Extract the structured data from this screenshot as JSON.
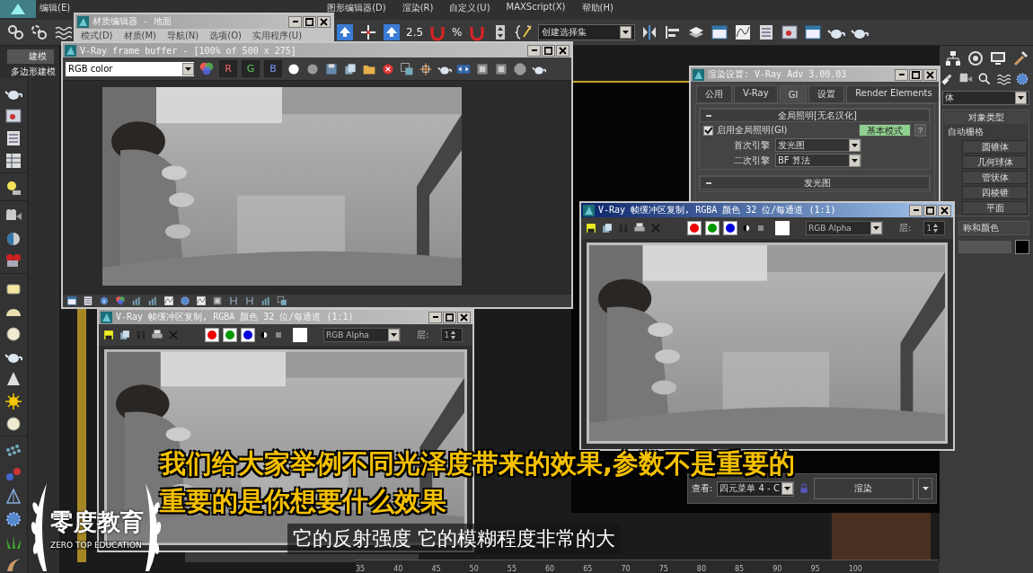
{
  "menu_bar": {
    "items": [
      "编辑(E)",
      "图形编辑器(D)",
      "渲染(R)",
      "自定义(U)",
      "MAXScript(X)",
      "帮助(H)"
    ]
  },
  "main_toolbar": {
    "snap_value": "2.5",
    "percent_label": "%",
    "selection_set": "创建选择集"
  },
  "ribbon": {
    "tab": "建模",
    "panel": "多边形建模"
  },
  "command_panel": {
    "category": "体",
    "section": "对象类型",
    "autogrid": "自动栅格",
    "buttons": [
      {
        "right": "圆锥体"
      },
      {
        "right": "几何球体"
      },
      {
        "right": "管状体"
      },
      {
        "right": "四棱锥"
      },
      {
        "right": "平面"
      }
    ],
    "name_section": "称和颜色"
  },
  "material_editor": {
    "title": "材质编辑器 - 地面",
    "active": false,
    "menu": [
      "模式(D)",
      "材质(M)",
      "导航(N)",
      "选项(O)",
      "实用程序(U)"
    ]
  },
  "frame_buffer": {
    "title": "V-Ray frame buffer - [100% of 500 x 275]",
    "active": false,
    "channel": "RGB color",
    "channel_buttons": [
      {
        "label": "R",
        "on": true
      },
      {
        "label": "G",
        "on": true
      },
      {
        "label": "B",
        "on": true
      }
    ]
  },
  "render_setup": {
    "title": "渲染设置: V-Ray Adv 3.00.03",
    "active": false,
    "tabs": [
      {
        "label": "公用",
        "selected": false
      },
      {
        "label": "V-Ray",
        "selected": false
      },
      {
        "label": "GI",
        "selected": true
      },
      {
        "label": "设置",
        "selected": false
      },
      {
        "label": "Render Elements",
        "selected": false
      }
    ],
    "rollouts": [
      {
        "title": "全局照明[无名汉化]",
        "checkbox": {
          "label": "启用全局照明(GI)",
          "checked": true
        },
        "mode": "基本模式",
        "help": "?",
        "fields": [
          {
            "label": "首次引擎",
            "value": "发光图"
          },
          {
            "label": "二次引擎",
            "value": "BF 算法"
          }
        ]
      },
      {
        "title": "发光图"
      }
    ]
  },
  "buffer_copies": [
    {
      "title": "V-Ray 帧缓冲区复制, RGBA 颜色 32 位/每通道 (1:1)",
      "active": false,
      "channel": "RGB Alpha",
      "layer_label": "层:",
      "layer": "1"
    },
    {
      "title": "V-Ray 帧缓冲区复制, RGBA 颜色 32 位/每通道 (1:1)",
      "active": true,
      "channel": "RGB Alpha",
      "layer_label": "层:",
      "layer": "1"
    }
  ],
  "render_panel": {
    "view_label": "查看:",
    "view": "四元菜单 4 - C",
    "render_button": "渲染"
  },
  "timeline": {
    "ticks": [
      "35",
      "40",
      "45",
      "50",
      "55",
      "60",
      "65",
      "70",
      "75",
      "80",
      "85",
      "90",
      "95",
      "100"
    ]
  },
  "subtitles": {
    "highlight": [
      "我们给大家举例不同光泽度带来的效果,参数不是重要的",
      "重要的是你想要什么效果"
    ],
    "caption": "它的反射强度 它的模糊程度非常的大"
  },
  "logo": {
    "name": "零度教育",
    "tagline": "ZERO TOP EDUCATION"
  }
}
